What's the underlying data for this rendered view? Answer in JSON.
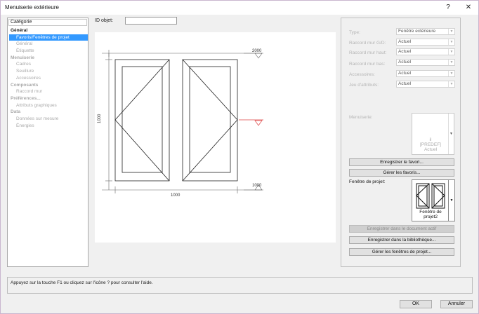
{
  "window": {
    "title": "Menuiserie extérieure",
    "help_button": "?",
    "close_button": "✕"
  },
  "category_panel": {
    "header": "Catégorie",
    "items": [
      {
        "label": "Général",
        "kind": "group",
        "enabled": true
      },
      {
        "label": "Favoris/Fenêtres de projet",
        "kind": "item",
        "selected": true
      },
      {
        "label": "Général",
        "kind": "item"
      },
      {
        "label": "Étiquette",
        "kind": "item"
      },
      {
        "label": "Menuiserie",
        "kind": "group"
      },
      {
        "label": "Cadres",
        "kind": "item"
      },
      {
        "label": "Seuillure",
        "kind": "item"
      },
      {
        "label": "Accessoires",
        "kind": "item"
      },
      {
        "label": "Composants",
        "kind": "group"
      },
      {
        "label": "Raccord mur",
        "kind": "item"
      },
      {
        "label": "Préférences...",
        "kind": "group"
      },
      {
        "label": "Attributs graphiques",
        "kind": "item"
      },
      {
        "label": "Data",
        "kind": "group"
      },
      {
        "label": "Données sur mesure",
        "kind": "item"
      },
      {
        "label": "Énergies",
        "kind": "item"
      }
    ]
  },
  "object_id": {
    "label": "ID objet:",
    "value": ""
  },
  "drawing": {
    "dim_top": "2000",
    "dim_bottom_right": "1000",
    "dim_left": "1000",
    "dim_bottom": "1000"
  },
  "properties": [
    {
      "label": "Type:",
      "value": "Fenêtre extérieure"
    },
    {
      "label": "Raccord mur G/D:",
      "value": "Actuel"
    },
    {
      "label": "Raccord mur haut:",
      "value": "Actuel"
    },
    {
      "label": "Raccord mur bas:",
      "value": "Actuel"
    },
    {
      "label": "Accessoires:",
      "value": "Actuel"
    },
    {
      "label": "Jeu d'attributs:",
      "value": "Actuel"
    }
  ],
  "favorites": {
    "label": "Menuiserie:",
    "line1": "il",
    "line2": "[PREDEF]",
    "line3": "Actuel"
  },
  "buttons": {
    "save_favorite": "Enregistrer le favori...",
    "manage_favorites": "Gérer les favoris...",
    "save_in_document": "Enregistrer dans le document actif",
    "save_in_library": "Enregistrer dans la bibliothèque...",
    "manage_project_windows": "Gérer les fenêtres de projet...",
    "ok": "OK",
    "cancel": "Annuler"
  },
  "project_window": {
    "label": "Fenêtre de projet:",
    "caption_line1": "Fenêtre de",
    "caption_line2": "projet2"
  },
  "help": {
    "text": "Appuyez sur la touche F1 ou cliquez sur l'icône ? pour consulter l'aide."
  }
}
